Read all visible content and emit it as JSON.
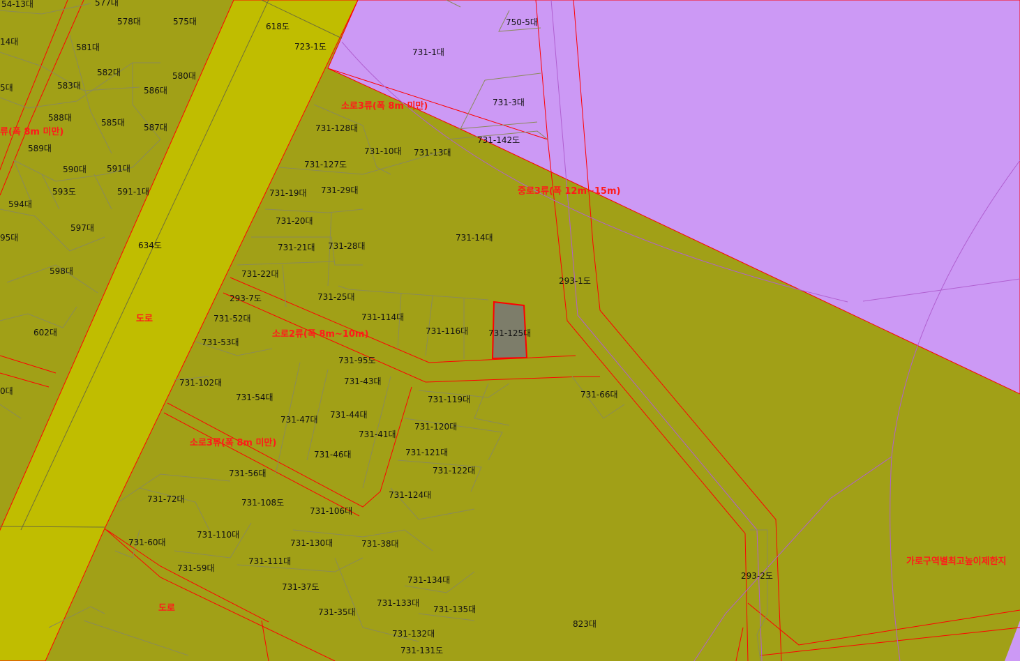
{
  "map": {
    "zone_colors": {
      "residential": "#a1a017",
      "road": "#c0bd00",
      "commercial": "#cc99f5",
      "boundary": "#ff0000",
      "parcel_line": "#8a8a5a",
      "selected": "#7d7d6a"
    },
    "selected_parcel": "731-125대",
    "parcel_labels": [
      "54-13대",
      "577대",
      "578대",
      "575대",
      "618도",
      "723-1도",
      "750-5대",
      "731-1대",
      "14대",
      "581대",
      "580대",
      "582대",
      "583대",
      "586대",
      "5대",
      "588대",
      "585대",
      "587대",
      "589대",
      "590대",
      "591대",
      "593도",
      "591-1대",
      "594대",
      "597대",
      "634도",
      "95대",
      "598대",
      "602대",
      "0대",
      "731-3대",
      "731-128대",
      "731-142도",
      "731-10대",
      "731-13대",
      "731-127도",
      "731-19대",
      "731-29대",
      "731-20대",
      "731-14대",
      "731-21대",
      "731-28대",
      "731-22대",
      "293-1도",
      "293-7도",
      "731-25대",
      "731-52대",
      "731-114대",
      "731-116대",
      "731-125대",
      "731-53대",
      "731-95도",
      "731-102대",
      "731-43대",
      "731-54대",
      "731-119대",
      "731-66대",
      "731-47대",
      "731-44대",
      "731-120대",
      "731-41대",
      "731-46대",
      "731-121대",
      "731-122대",
      "731-56대",
      "731-72대",
      "731-108도",
      "731-106대",
      "731-124대",
      "731-110대",
      "731-60대",
      "731-130대",
      "731-38대",
      "731-111대",
      "731-59대",
      "731-37도",
      "731-134대",
      "293-2도",
      "731-133대",
      "731-35대",
      "731-135대",
      "823대",
      "731-132대",
      "731-131도"
    ],
    "road_labels": [
      "소로3류(폭 8m 미만)",
      "류(폭 8m 미만)",
      "중로3류(폭 12m~15m)",
      "도로",
      "소로2류(폭 8m~10m)",
      "소로3류(폭 8m 미만)",
      "도로",
      "가로구역별최고높이제한지"
    ]
  }
}
